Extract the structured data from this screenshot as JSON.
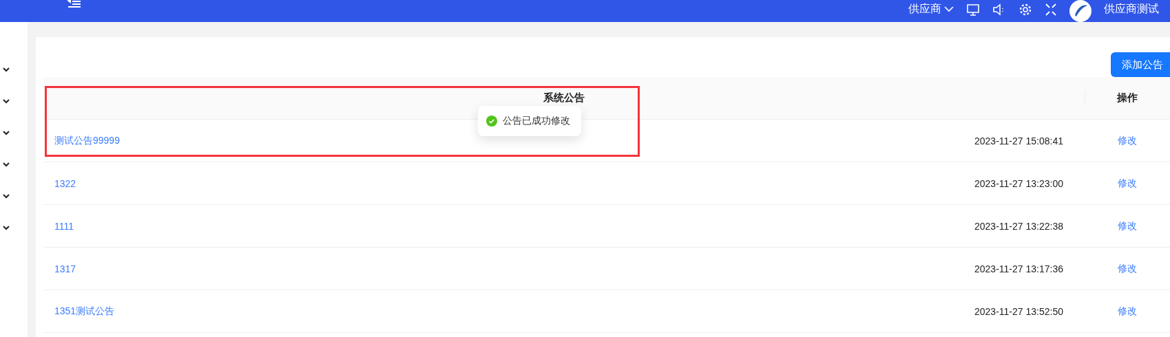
{
  "header": {
    "role_menu": "供应商",
    "user_name": "供应商测试"
  },
  "sidebar": {
    "items": [
      {
        "expanded": false
      },
      {
        "expanded": false
      },
      {
        "expanded": false
      },
      {
        "expanded": false
      },
      {
        "expanded": false
      },
      {
        "expanded": false
      }
    ]
  },
  "toolbar": {
    "add_button": "添加公告"
  },
  "table": {
    "columns": [
      "系统公告",
      "操作"
    ],
    "rows": [
      {
        "title": "测试公告99999",
        "time": "2023-11-27 15:08:41",
        "action": "修改"
      },
      {
        "title": "1322",
        "time": "2023-11-27 13:23:00",
        "action": "修改"
      },
      {
        "title": "1111",
        "time": "2023-11-27 13:22:38",
        "action": "修改"
      },
      {
        "title": "1317",
        "time": "2023-11-27 13:17:36",
        "action": "修改"
      },
      {
        "title": "1351测试公告",
        "time": "2023-11-27 13:52:50",
        "action": "修改"
      }
    ]
  },
  "toast": {
    "kind": "success",
    "message": "公告已成功修改"
  }
}
